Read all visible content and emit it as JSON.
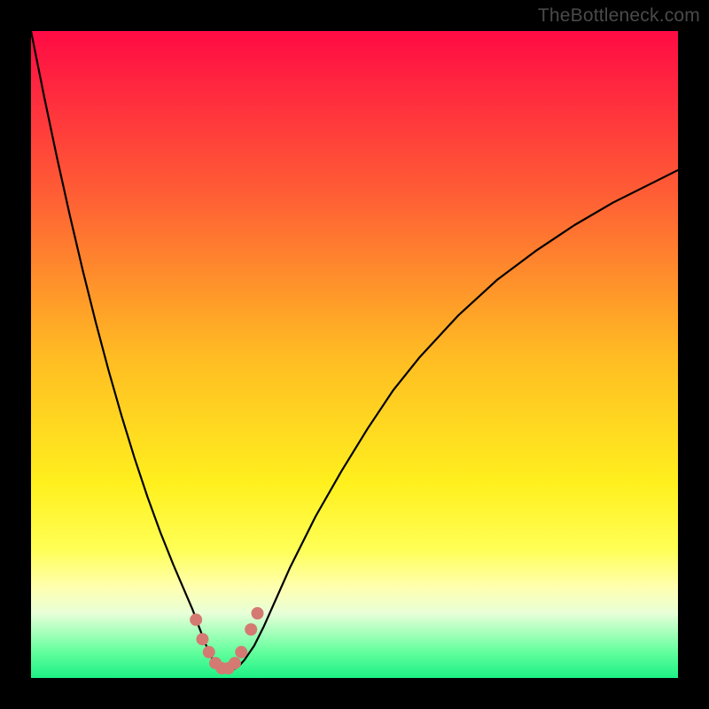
{
  "watermark": "TheBottleneck.com",
  "chart_data": {
    "type": "line",
    "title": "",
    "xlabel": "",
    "ylabel": "",
    "xlim": [
      0,
      100
    ],
    "ylim": [
      0,
      100
    ],
    "background_gradient": {
      "stops": [
        {
          "offset": 0,
          "color": "#ff0b44"
        },
        {
          "offset": 25,
          "color": "#ff5d35"
        },
        {
          "offset": 50,
          "color": "#ffbb23"
        },
        {
          "offset": 70,
          "color": "#fff01e"
        },
        {
          "offset": 80,
          "color": "#ffff55"
        },
        {
          "offset": 86,
          "color": "#ffffb0"
        },
        {
          "offset": 90,
          "color": "#e8ffd8"
        },
        {
          "offset": 96,
          "color": "#63ff9d"
        },
        {
          "offset": 100,
          "color": "#1cf085"
        }
      ]
    },
    "series": [
      {
        "name": "bottleneck-curve",
        "x": [
          0,
          2,
          4,
          6,
          8,
          10,
          12,
          14,
          16,
          18,
          20,
          22,
          23.5,
          25,
          26,
          27,
          27.8,
          28.5,
          29,
          30,
          31,
          32,
          33,
          34.5,
          36,
          38,
          40,
          44,
          48,
          52,
          56,
          60,
          66,
          72,
          78,
          84,
          90,
          96,
          100
        ],
        "y": [
          100,
          90,
          80.5,
          71.5,
          63,
          55,
          47.5,
          40.5,
          34,
          28,
          22.5,
          17.5,
          14,
          10.5,
          7.8,
          5.2,
          3.4,
          2.2,
          1.6,
          1.2,
          1.2,
          1.7,
          2.8,
          5.0,
          8.0,
          12.5,
          17.0,
          25.0,
          32.0,
          38.5,
          44.5,
          49.5,
          56.0,
          61.5,
          66.0,
          70.0,
          73.5,
          76.5,
          78.5
        ]
      }
    ],
    "markers": {
      "name": "bottleneck-markers",
      "color": "#d47a72",
      "radius_px": 7,
      "points": [
        {
          "x": 25.5,
          "y": 9.0
        },
        {
          "x": 26.5,
          "y": 6.0
        },
        {
          "x": 27.5,
          "y": 4.0
        },
        {
          "x": 28.5,
          "y": 2.3
        },
        {
          "x": 29.5,
          "y": 1.5
        },
        {
          "x": 30.5,
          "y": 1.5
        },
        {
          "x": 31.5,
          "y": 2.3
        },
        {
          "x": 32.5,
          "y": 4.0
        },
        {
          "x": 34.0,
          "y": 7.5
        },
        {
          "x": 35.0,
          "y": 10.0
        }
      ]
    }
  }
}
